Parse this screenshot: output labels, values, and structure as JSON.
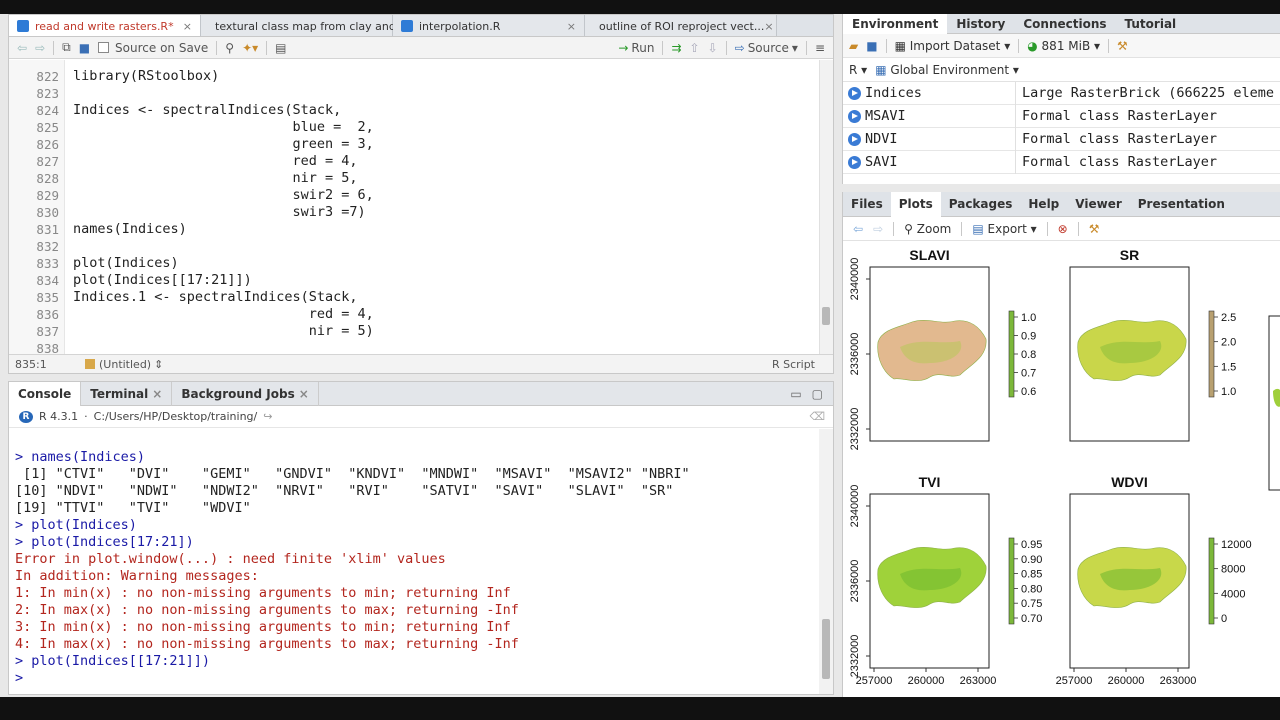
{
  "editor": {
    "tabs": [
      {
        "label": "read and write rasters.R*"
      },
      {
        "label": "textural class map from clay and sand r..."
      },
      {
        "label": "interpolation.R"
      },
      {
        "label": "outline of ROI reproject vect..."
      }
    ],
    "toolbar": {
      "source_on_save": "Source on Save",
      "run": "Run",
      "source": "Source"
    },
    "lines": [
      {
        "n": "822",
        "t": "library(RStoolbox)"
      },
      {
        "n": "823",
        "t": ""
      },
      {
        "n": "824",
        "t": "Indices <- spectralIndices(Stack,"
      },
      {
        "n": "825",
        "t": "                           blue =  2,"
      },
      {
        "n": "826",
        "t": "                           green = 3,"
      },
      {
        "n": "827",
        "t": "                           red = 4,"
      },
      {
        "n": "828",
        "t": "                           nir = 5,"
      },
      {
        "n": "829",
        "t": "                           swir2 = 6,"
      },
      {
        "n": "830",
        "t": "                           swir3 =7)"
      },
      {
        "n": "831",
        "t": "names(Indices)"
      },
      {
        "n": "832",
        "t": ""
      },
      {
        "n": "833",
        "t": "plot(Indices)"
      },
      {
        "n": "834",
        "t": "plot(Indices[[17:21]])"
      },
      {
        "n": "835",
        "t": "Indices.1 <- spectralIndices(Stack,"
      },
      {
        "n": "836",
        "t": "                             red = 4,"
      },
      {
        "n": "837",
        "t": "                             nir = 5)"
      },
      {
        "n": "838",
        "t": ""
      }
    ],
    "status": {
      "pos": "835:1",
      "scope": "(Untitled)",
      "type": "R Script"
    }
  },
  "console": {
    "tabs": [
      "Console",
      "Terminal",
      "Background Jobs"
    ],
    "r_version": "R 4.3.1",
    "path": "C:/Users/HP/Desktop/training/",
    "lines": [
      {
        "cls": "prompt",
        "t": "> names(Indices)"
      },
      {
        "cls": "",
        "t": " [1] \"CTVI\"   \"DVI\"    \"GEMI\"   \"GNDVI\"  \"KNDVI\"  \"MNDWI\"  \"MSAVI\"  \"MSAVI2\" \"NBRI\""
      },
      {
        "cls": "",
        "t": "[10] \"NDVI\"   \"NDWI\"   \"NDWI2\"  \"NRVI\"   \"RVI\"    \"SATVI\"  \"SAVI\"   \"SLAVI\"  \"SR\""
      },
      {
        "cls": "",
        "t": "[19] \"TTVI\"   \"TVI\"    \"WDVI\""
      },
      {
        "cls": "prompt",
        "t": "> plot(Indices)"
      },
      {
        "cls": "prompt",
        "t": "> plot(Indices[17:21])"
      },
      {
        "cls": "err",
        "t": "Error in plot.window(...) : need finite 'xlim' values"
      },
      {
        "cls": "err",
        "t": "In addition: Warning messages:"
      },
      {
        "cls": "err",
        "t": "1: In min(x) : no non-missing arguments to min; returning Inf"
      },
      {
        "cls": "err",
        "t": "2: In max(x) : no non-missing arguments to max; returning -Inf"
      },
      {
        "cls": "err",
        "t": "3: In min(x) : no non-missing arguments to min; returning Inf"
      },
      {
        "cls": "err",
        "t": "4: In max(x) : no non-missing arguments to max; returning -Inf"
      },
      {
        "cls": "prompt",
        "t": "> plot(Indices[[17:21]])"
      },
      {
        "cls": "prompt",
        "t": "> "
      }
    ]
  },
  "env": {
    "tabs": [
      "Environment",
      "History",
      "Connections",
      "Tutorial"
    ],
    "import": "Import Dataset",
    "memory": "881 MiB",
    "lang": "R",
    "scope": "Global Environment",
    "rows": [
      {
        "name": "Indices",
        "value": "Large RasterBrick (666225 eleme"
      },
      {
        "name": "MSAVI",
        "value": "Formal class  RasterLayer"
      },
      {
        "name": "NDVI",
        "value": "Formal class  RasterLayer"
      },
      {
        "name": "SAVI",
        "value": "Formal class  RasterLayer"
      }
    ]
  },
  "plots": {
    "tabs": [
      "Files",
      "Plots",
      "Packages",
      "Help",
      "Viewer",
      "Presentation"
    ],
    "zoom": "Zoom",
    "export": "Export",
    "panels": [
      {
        "title": "SLAVI",
        "legend": [
          "1.0",
          "0.9",
          "0.8",
          "0.7",
          "0.6"
        ],
        "fill": "#e2b98f"
      },
      {
        "title": "SR",
        "legend": [
          "2.5",
          "2.0",
          "1.5",
          "1.0"
        ],
        "fill": "#c9d64a"
      },
      {
        "title": "TVI",
        "legend": [
          "0.95",
          "0.90",
          "0.85",
          "0.80",
          "0.75",
          "0.70"
        ],
        "fill": "#9fd23a"
      },
      {
        "title": "WDVI",
        "legend": [
          "12000",
          "8000",
          "4000",
          "0"
        ],
        "fill": "#c8d84a"
      }
    ],
    "y_ticks": [
      "2340000",
      "2336000",
      "2332000"
    ],
    "x_ticks": [
      "257000",
      "260000",
      "263000"
    ]
  },
  "colors": {
    "prompt": "#1a1aa6",
    "error": "#b3261e",
    "accent": "#2e7bd6"
  }
}
